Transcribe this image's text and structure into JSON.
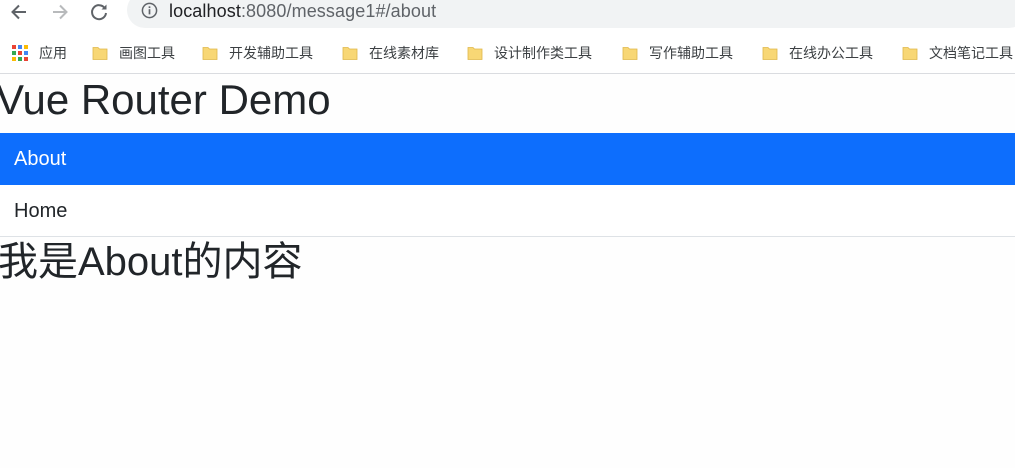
{
  "browser": {
    "url_host": "localhost",
    "url_rest": ":8080/message1#/about"
  },
  "bookmarks": [
    {
      "label": "应用",
      "icon": "apps-grid-icon"
    },
    {
      "label": "画图工具",
      "icon": "folder-icon"
    },
    {
      "label": "开发辅助工具",
      "icon": "folder-icon"
    },
    {
      "label": "在线素材库",
      "icon": "folder-icon"
    },
    {
      "label": "设计制作类工具",
      "icon": "folder-icon"
    },
    {
      "label": "写作辅助工具",
      "icon": "folder-icon"
    },
    {
      "label": "在线办公工具",
      "icon": "folder-icon"
    },
    {
      "label": "文档笔记工具",
      "icon": "folder-icon"
    }
  ],
  "page": {
    "title": "Vue Router Demo",
    "nav": [
      {
        "label": "About",
        "active": true
      },
      {
        "label": "Home",
        "active": false
      }
    ],
    "content": "我是About的内容"
  },
  "colors": {
    "active_nav": "#0d6efd",
    "folder": "#f8d775"
  }
}
